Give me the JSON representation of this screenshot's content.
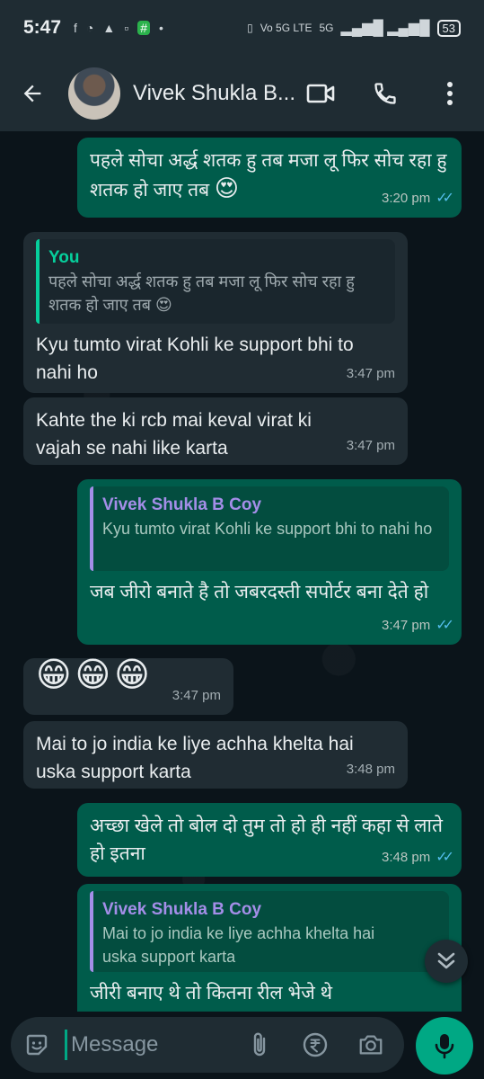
{
  "status_bar": {
    "time": "5:47",
    "network": "Vo 5G LTE",
    "signal_5g": "5G",
    "battery": "53"
  },
  "header": {
    "contact_name": "Vivek Shukla B..."
  },
  "messages": [
    {
      "direction": "out",
      "text": "पहले सोचा अर्द्ध शतक हु तब मजा लू फिर सोच रहा हु शतक हो जाए तब",
      "emoji": "😍",
      "time": "3:20 pm",
      "ticks": "✓✓"
    },
    {
      "direction": "in",
      "quote_author": "You",
      "quote_text": "पहले सोचा अर्द्ध शतक हु तब मजा लू फिर सोच रहा हु शतक हो जाए तब 😍",
      "text": "Kyu tumto virat Kohli ke support bhi to nahi ho",
      "time": "3:47 pm"
    },
    {
      "direction": "in",
      "text": "Kahte the ki rcb mai keval virat ki vajah se nahi like karta",
      "time": "3:47 pm"
    },
    {
      "direction": "out",
      "quote_author": "Vivek Shukla B Coy",
      "quote_text": "Kyu tumto virat Kohli ke support bhi to nahi ho",
      "text": "जब जीरो बनाते है तो जबरदस्ती सपोर्टर बना देते हो",
      "time": "3:47 pm",
      "ticks": "✓✓"
    },
    {
      "direction": "in",
      "text": "😁😁😁",
      "time": "3:47 pm"
    },
    {
      "direction": "in",
      "text": "Mai to jo india ke liye achha khelta hai uska support karta",
      "time": "3:48 pm"
    },
    {
      "direction": "out",
      "text": "अच्छा खेले तो बोल दो तुम तो हो ही नहीं कहा से लाते हो इतना",
      "time": "3:48 pm",
      "ticks": "✓✓"
    },
    {
      "direction": "out",
      "quote_author": "Vivek Shukla B Coy",
      "quote_text": "Mai to jo india ke liye achha khelta hai uska support karta",
      "text": "जीरी बनाए थे तो कितना रील भेजे थे"
    }
  ],
  "composer": {
    "placeholder": "Message"
  },
  "icons": {
    "back": "arrow-left-icon",
    "video": "video-call-icon",
    "call": "phone-icon",
    "menu": "more-vert-icon",
    "emoji": "sticker-icon",
    "attach": "paperclip-icon",
    "rupee": "rupee-icon",
    "camera": "camera-icon",
    "mic": "mic-icon",
    "scroll": "double-chevron-down-icon"
  },
  "colors": {
    "outgoing_bubble": "#005c4b",
    "incoming_bubble": "#202c33",
    "accent": "#00a884",
    "read_ticks": "#53bdeb"
  }
}
